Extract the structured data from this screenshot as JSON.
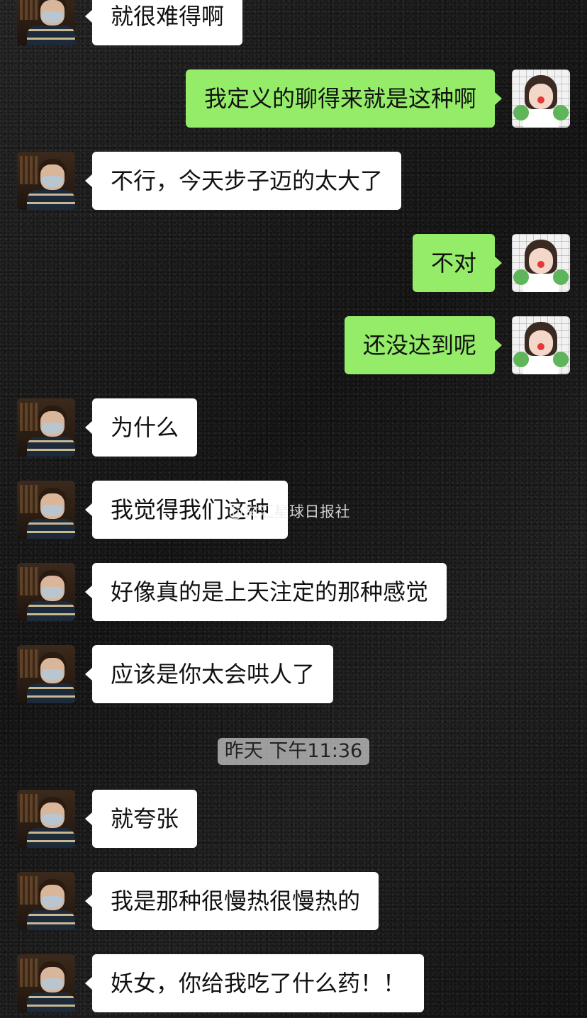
{
  "messages": [
    {
      "side": "in",
      "text": "就很难得啊"
    },
    {
      "side": "out",
      "text": "我定义的聊得来就是这种啊"
    },
    {
      "side": "in",
      "text": "不行，今天步子迈的太大了"
    },
    {
      "side": "out",
      "text": "不对"
    },
    {
      "side": "out",
      "text": "还没达到呢"
    },
    {
      "side": "in",
      "text": "为什么"
    },
    {
      "side": "in",
      "text": "我觉得我们这种"
    },
    {
      "side": "in",
      "text": "好像真的是上天注定的那种感觉"
    },
    {
      "side": "in",
      "text": "应该是你太会哄人了"
    },
    {
      "side": "in",
      "text": "就夸张"
    },
    {
      "side": "in",
      "text": "我是那种很慢热很慢热的"
    },
    {
      "side": "in",
      "text": "妖女，你给我吃了什么药！！"
    }
  ],
  "timestamp": "昨天 下午11:36",
  "watermark": "@文汇星球日报社",
  "avatars": {
    "incoming": "boy-with-mask-avatar",
    "outgoing": "girl-with-green-gloves-avatar"
  },
  "colors": {
    "incoming_bubble": "#ffffff",
    "outgoing_bubble": "#95ec69",
    "background": "#1a1a1a"
  }
}
